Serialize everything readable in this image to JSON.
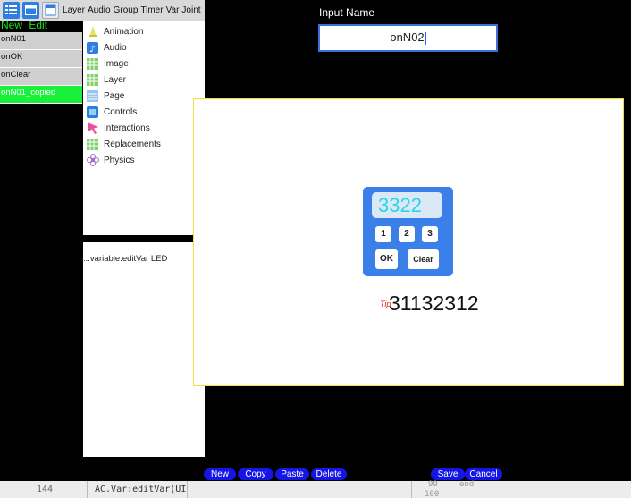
{
  "toolbar": {
    "tabs": [
      "Layer",
      "Audio",
      "Group",
      "Timer",
      "Var",
      "Joint"
    ]
  },
  "newedit": {
    "new_label": "New",
    "edit_label": "Edit"
  },
  "left_list": [
    {
      "label": "onN01"
    },
    {
      "label": "onOK"
    },
    {
      "label": "onClear"
    },
    {
      "label": "onN01_copied"
    }
  ],
  "categories": [
    {
      "label": "Animation",
      "icon": "animation-icon"
    },
    {
      "label": "Audio",
      "icon": "audio-icon"
    },
    {
      "label": "Image",
      "icon": "image-icon"
    },
    {
      "label": "Layer",
      "icon": "layer-icon"
    },
    {
      "label": "Page",
      "icon": "page-icon"
    },
    {
      "label": "Controls",
      "icon": "controls-icon"
    },
    {
      "label": "Interactions",
      "icon": "interactions-icon"
    },
    {
      "label": "Replacements",
      "icon": "replacements-icon"
    },
    {
      "label": "Physics",
      "icon": "physics-icon"
    }
  ],
  "variable_row": "...variable.editVar LED",
  "input": {
    "label": "Input Name",
    "value": "onN02"
  },
  "preview": {
    "display": "3322",
    "keys": [
      "1",
      "2",
      "3"
    ],
    "ok": "OK",
    "clear": "Clear",
    "counter": "31132312",
    "tip": "Tip"
  },
  "bottom_buttons": {
    "new": "New",
    "copy": "Copy",
    "paste": "Paste",
    "delete": "Delete",
    "save": "Save",
    "cancel": "Cancel"
  },
  "code": {
    "line_number": "144",
    "text": "AC.Var:editVar(UI",
    "right_a": "99",
    "right_b": "end",
    "right_c": "100"
  },
  "colors": {
    "accent_blue": "#3b7fe8",
    "selected_green": "#19f03a",
    "pill_blue": "#1515e5"
  }
}
